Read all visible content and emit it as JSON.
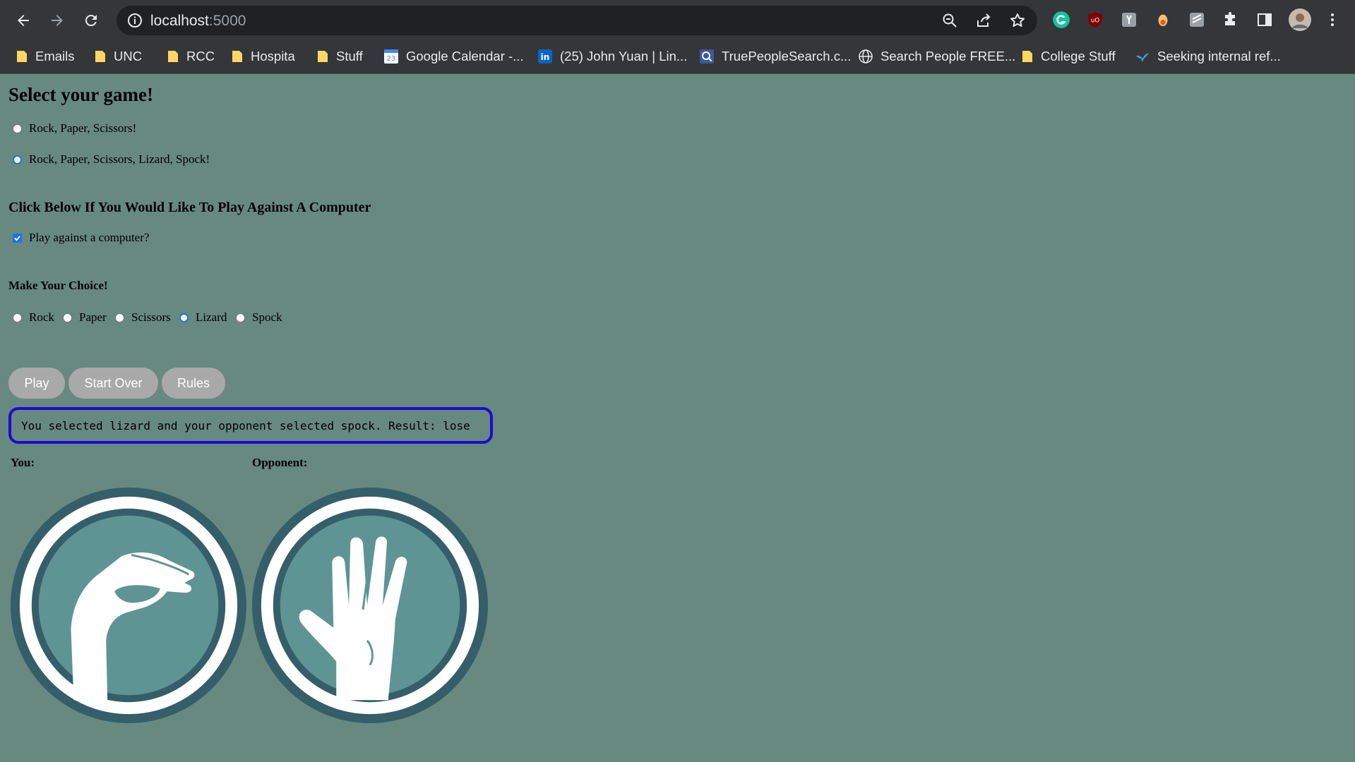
{
  "browser": {
    "url_host": "localhost",
    "url_port": ":5000",
    "bookmarks": [
      {
        "label": "Emails"
      },
      {
        "label": "UNC"
      },
      {
        "label": "RCC"
      },
      {
        "label": "Hospita"
      },
      {
        "label": "Stuff"
      },
      {
        "label": "Google Calendar -..."
      },
      {
        "label": "(25) John Yuan | Lin..."
      },
      {
        "label": "TruePeopleSearch.c..."
      },
      {
        "label": "Search People FREE..."
      },
      {
        "label": "College Stuff"
      },
      {
        "label": "Seeking internal ref..."
      }
    ]
  },
  "page": {
    "title": "Select your game!",
    "game_options": [
      {
        "label": "Rock, Paper, Scissors!",
        "selected": false
      },
      {
        "label": "Rock, Paper, Scissors, Lizard, Spock!",
        "selected": true
      }
    ],
    "computer_heading": "Click Below If You Would Like To Play Against A Computer",
    "computer_checkbox_label": "Play against a computer?",
    "computer_checked": true,
    "choice_heading": "Make Your Choice!",
    "choices": [
      {
        "label": "Rock",
        "selected": false
      },
      {
        "label": "Paper",
        "selected": false
      },
      {
        "label": "Scissors",
        "selected": false
      },
      {
        "label": "Lizard",
        "selected": true
      },
      {
        "label": "Spock",
        "selected": false
      }
    ],
    "buttons": {
      "play": "Play",
      "start_over": "Start Over",
      "rules": "Rules"
    },
    "result_text": "You selected lizard and your opponent selected spock. Result: lose",
    "you_label": "You:",
    "opponent_label": "Opponent:",
    "you_choice_icon": "lizard-hand-icon",
    "opponent_choice_icon": "spock-hand-icon"
  },
  "colors": {
    "page_bg": "#67897f",
    "button_bg": "#a9a9a9",
    "result_border": "#1a0bd6",
    "icon_ring": "#355e6b",
    "icon_fill": "#5f9495"
  }
}
